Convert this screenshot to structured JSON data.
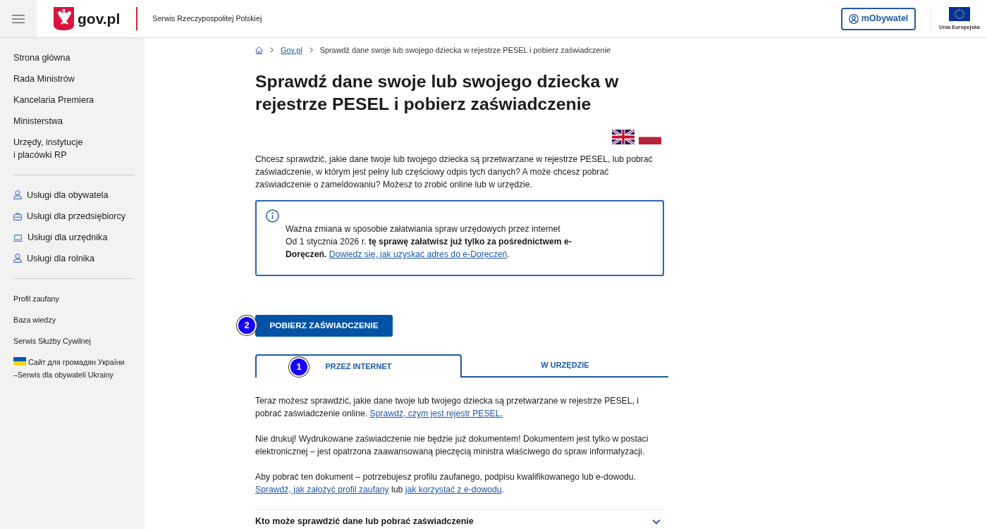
{
  "header": {
    "logo_text": "gov.pl",
    "tagline": "Serwis Rzeczypospolitej Polskiej",
    "account_button": "mObywatel",
    "eu_label": "Unia Europejska"
  },
  "sidebar": {
    "groups": [
      {
        "kind": "main",
        "items": [
          "Strona główna",
          "Rada Ministrów",
          "Kancelaria Premiera",
          "Ministerstwa",
          "Urzędy, instytucje\ni placówki RP"
        ]
      },
      {
        "kind": "services",
        "items": [
          "Usługi dla obywatela",
          "Usługi dla przedsiębiorcy",
          "Usługi dla urzędnika",
          "Usługi dla rolnika"
        ]
      },
      {
        "kind": "links",
        "items": [
          "Profil zaufany",
          "Baza wiedzy",
          "Serwis Służby Cywilnej",
          "Сайт для громадян України\n–Serwis dla obywateli Ukrainy"
        ]
      }
    ]
  },
  "breadcrumb": [
    {
      "label": "Gov.pl",
      "current": false
    },
    {
      "label": "Sprawdź dane swoje lub swojego dziecka w rejestrze PESEL i pobierz zaświadczenie",
      "current": true
    }
  ],
  "page_title": "Sprawdź dane swoje lub swojego dziecka w rejestrze PESEL i pobierz zaświadczenie",
  "intro": "Chcesz sprawdzić, jakie dane twoje lub twojego dziecka są przetwarzane w rejestrze PESEL, lub pobrać zaświadczenie, w którym jest pełny lub częściowy odpis tych danych? A może chcesz pobrać zaświadczenie o zameldowaniu? Możesz to zrobić online lub w urzędzie.",
  "notice": {
    "heading": "Ważna zmiana w sposobie załatwiania spraw urzędowych przez internet",
    "body": "Od 1 stycznia 2026 r. **tę sprawę załatwisz już tylko za pośrednictwem e-Doręczeń.**",
    "link": "Dowiedz się, jak uzyskać adres do e-Doręczeń",
    "tail": "."
  },
  "download_button": {
    "label": "POBIERZ ZAŚWIADCZENIE",
    "marker": "2"
  },
  "tabs": [
    {
      "label": "PRZEZ INTERNET",
      "selected": true,
      "marker": "1"
    },
    {
      "label": "W URZĘDZIE",
      "selected": false
    }
  ],
  "tab_content": [
    {
      "parts": [
        {
          "kind": "text",
          "text": "Teraz możesz sprawdzić, jakie dane twoje lub twojego dziecka są przetwarzane w rejestrze PESEL, i pobrać zaświadczenie online. "
        },
        {
          "kind": "link",
          "text": "Sprawdź, czym jest rejestr PESEL."
        }
      ]
    },
    {
      "parts": [
        {
          "kind": "text",
          "text": "Nie drukuj! Wydrukowane zaświadczenie nie będzie już dokumentem! Dokumentem jest tylko w postaci elektronicznej – jest opatrzona zaawansowaną pieczęcią ministra właściwego do spraw informatyzacji."
        }
      ]
    },
    {
      "parts": [
        {
          "kind": "text",
          "text": "Aby pobrać ten dokument – potrzebujesz profilu zaufanego, podpisu kwalifikowanego lub e-dowodu. "
        },
        {
          "kind": "link",
          "text": "Sprawdź, jak założyć profil zaufany"
        },
        {
          "kind": "text",
          "text": " lub "
        },
        {
          "kind": "link",
          "text": "jak korzystać z e-dowodu"
        },
        {
          "kind": "text",
          "text": "."
        }
      ]
    }
  ],
  "accordion": [
    {
      "title": "Kto może sprawdzić dane lub pobrać zaświadczenie",
      "expanded": false
    }
  ]
}
